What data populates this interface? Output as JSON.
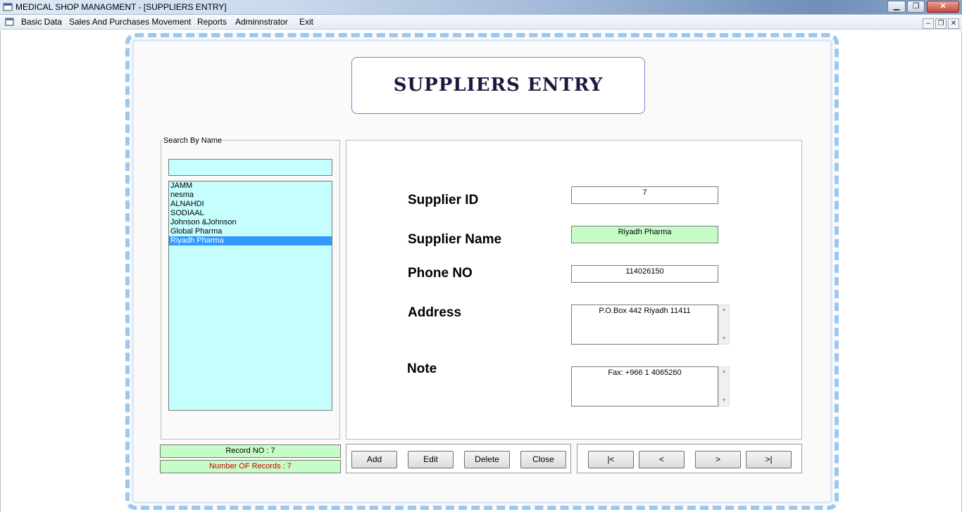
{
  "window": {
    "title": "MEDICAL SHOP MANAGMENT - [SUPPLIERS ENTRY]",
    "min_label": "▁",
    "max_label": "❐",
    "close_label": "✕"
  },
  "menu": {
    "items": [
      "Basic Data",
      "Sales And Purchases Movement",
      "Reports",
      "Adminnstrator",
      "Exit"
    ],
    "mdi_min": "–",
    "mdi_restore": "❐",
    "mdi_close": "✕"
  },
  "form": {
    "title": "SUPPLIERS ENTRY",
    "search": {
      "legend": "Search By Name",
      "query": "",
      "items": [
        "JAMM",
        "nesma",
        "ALNAHDI",
        "SODIAAL",
        "Johnson &Johnson",
        "Global Pharma",
        "Riyadh Pharma"
      ],
      "selected_index": 6
    },
    "status": {
      "record_no": "Record NO : 7",
      "record_count": "Number OF Records : 7"
    },
    "fields": {
      "supplier_id_label": "Supplier ID",
      "supplier_id": "7",
      "supplier_name_label": "Supplier Name",
      "supplier_name": "Riyadh Pharma",
      "phone_label": "Phone NO",
      "phone": "114026150",
      "address_label": "Address",
      "address": "P.O.Box 442 Riyadh 11411",
      "note_label": "Note",
      "note": "Fax: +966 1 4065260"
    },
    "actions": {
      "add": "Add",
      "edit": "Edit",
      "delete": "Delete",
      "close": "Close"
    },
    "navigation": {
      "first": "|<",
      "prev": "<",
      "next": ">",
      "last": ">|"
    },
    "scroll_up": "▲",
    "scroll_down": "▼"
  },
  "colors": {
    "field_cyan": "#c6fdfd",
    "field_green": "#c6fcc6",
    "selection": "#3399ff",
    "frame_blue": "#9cc7ee",
    "title_navy": "#1a1a40",
    "count_red": "#cc0000"
  },
  "icons": {
    "app": "app-window-icon",
    "menu": "mdi-child-icon"
  }
}
